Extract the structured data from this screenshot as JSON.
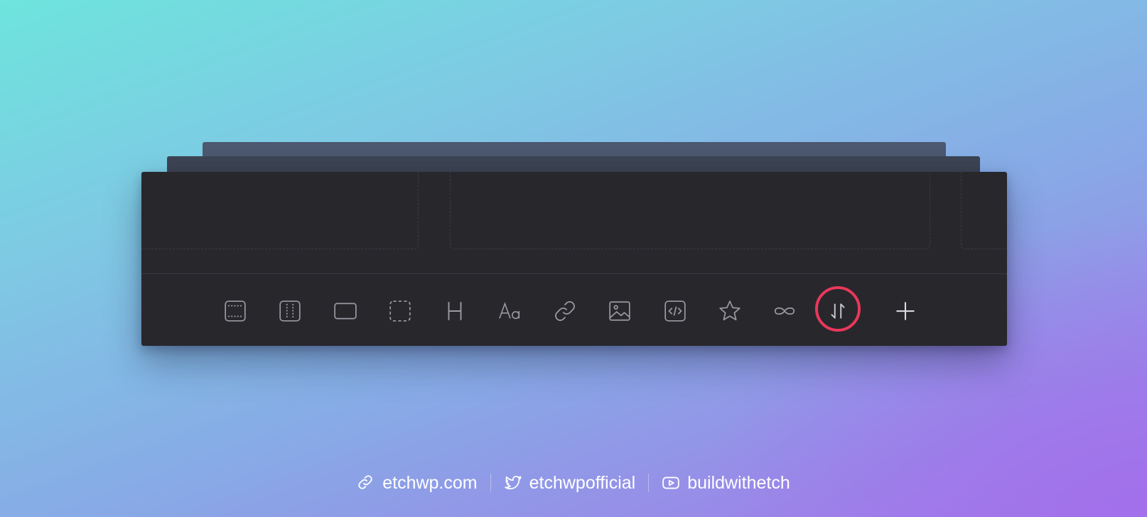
{
  "toolbar": {
    "tools": [
      {
        "name": "section",
        "icon": "section-icon"
      },
      {
        "name": "container",
        "icon": "container-icon"
      },
      {
        "name": "block",
        "icon": "block-icon"
      },
      {
        "name": "div",
        "icon": "div-icon"
      },
      {
        "name": "heading",
        "icon": "heading-icon",
        "glyph": "H"
      },
      {
        "name": "text",
        "icon": "text-icon",
        "glyph": "Aa"
      },
      {
        "name": "link",
        "icon": "link-icon"
      },
      {
        "name": "image",
        "icon": "image-icon"
      },
      {
        "name": "code",
        "icon": "code-icon"
      },
      {
        "name": "component",
        "icon": "star-icon"
      },
      {
        "name": "loop",
        "icon": "infinity-icon"
      },
      {
        "name": "sort",
        "icon": "sort-arrows-icon",
        "highlighted": true
      },
      {
        "name": "add",
        "icon": "plus-icon"
      }
    ],
    "highlight_color": "#e8385a"
  },
  "footer": {
    "website": "etchwp.com",
    "twitter": "etchwpofficial",
    "youtube": "buildwithetch"
  },
  "colors": {
    "panel": "#27272c",
    "icon": "#9a9aa2",
    "accent": "#e8385a"
  }
}
